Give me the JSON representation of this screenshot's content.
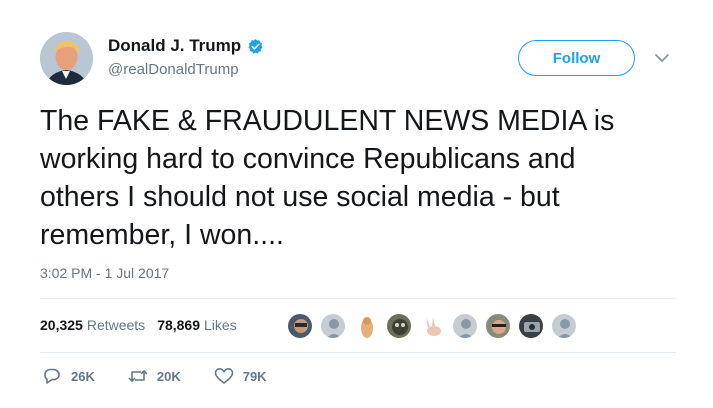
{
  "author": {
    "name": "Donald J. Trump",
    "handle": "@realDonaldTrump"
  },
  "follow_label": "Follow",
  "tweet": {
    "text": "The FAKE & FRAUDULENT NEWS MEDIA is\nworking hard to convince Republicans and\nothers I should not use social media - but\nremember, I won....",
    "timestamp": "3:02 PM - 1 Jul 2017"
  },
  "stats": {
    "retweets_count": "20,325",
    "retweets_label": "Retweets",
    "likes_count": "78,869",
    "likes_label": "Likes"
  },
  "actions": {
    "reply_count": "26K",
    "retweet_count": "20K",
    "like_count": "79K"
  },
  "icons": [
    "verified-badge-icon",
    "chevron-down-icon",
    "reply-icon",
    "retweet-icon",
    "heart-icon"
  ],
  "colors": {
    "accent": "#1da1f2",
    "secondary_text": "#657786",
    "primary_text": "#14171a",
    "divider": "#e6ecf0"
  }
}
